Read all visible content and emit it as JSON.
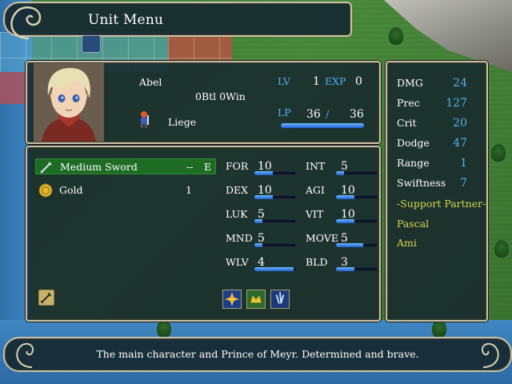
{
  "window": {
    "title": "Unit Menu"
  },
  "unit": {
    "name": "Abel",
    "record": "0Btl 0Win",
    "class": "Liege",
    "lv_label": "LV",
    "lv": "1",
    "exp_label": "EXP",
    "exp": "0",
    "lp_label": "LP",
    "lp_current": "36",
    "lp_sep": "/",
    "lp_max": "36",
    "lp_fraction": 1.0
  },
  "items": [
    {
      "name": "Medium Sword",
      "uses": "--",
      "equip": "E",
      "icon": "sword-icon",
      "selected": true
    },
    {
      "name": "Gold",
      "uses": "1",
      "equip": "",
      "icon": "gold-coin-icon",
      "selected": false
    }
  ],
  "stats": [
    {
      "label": "FOR",
      "value": "10",
      "fill": 0.45
    },
    {
      "label": "INT",
      "value": "5",
      "fill": 0.2
    },
    {
      "label": "DEX",
      "value": "10",
      "fill": 0.45
    },
    {
      "label": "AGI",
      "value": "10",
      "fill": 0.45
    },
    {
      "label": "LUK",
      "value": "5",
      "fill": 0.2
    },
    {
      "label": "VIT",
      "value": "10",
      "fill": 0.45
    },
    {
      "label": "MND",
      "value": "5",
      "fill": 0.2
    },
    {
      "label": "MOVE",
      "value": "5",
      "fill": 0.65
    },
    {
      "label": "WLV",
      "value": "4",
      "fill": 0.95
    },
    {
      "label": "BLD",
      "value": "3",
      "fill": 0.45
    }
  ],
  "combat": [
    {
      "label": "DMG",
      "value": "24"
    },
    {
      "label": "Prec",
      "value": "127"
    },
    {
      "label": "Crit",
      "value": "20"
    },
    {
      "label": "Dodge",
      "value": "47"
    },
    {
      "label": "Range",
      "value": "1"
    },
    {
      "label": "Swiftness",
      "value": "7"
    }
  ],
  "support": {
    "heading": "-Support Partner-",
    "partners": [
      "Pascal",
      "Ami"
    ]
  },
  "skills": [
    "sword-skill-icon",
    "burst-skill-icon",
    "crest-skill-icon",
    "spirit-skill-icon"
  ],
  "description": "The main character and Prince of Meyr. Determined and brave.",
  "colors": {
    "accent_blue": "#4fb0f2",
    "support_yellow": "#d6d650",
    "selected_green": "#1e6b24",
    "gauge_blue": "#3b8cff"
  }
}
